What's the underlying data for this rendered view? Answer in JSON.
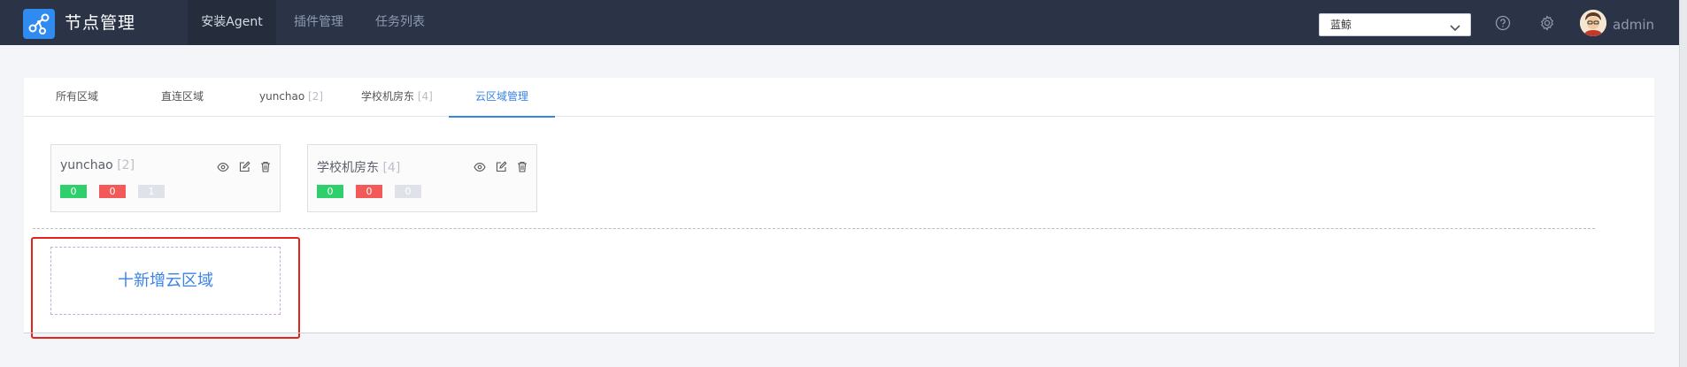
{
  "app": {
    "title": "节点管理"
  },
  "nav": {
    "items": [
      {
        "label": "安装Agent",
        "active": true
      },
      {
        "label": "插件管理",
        "active": false
      },
      {
        "label": "任务列表",
        "active": false
      }
    ]
  },
  "header": {
    "business_select": {
      "value": "蓝鲸"
    },
    "help_icon": "question-circle-icon",
    "settings_icon": "gear-icon",
    "user": {
      "name": "admin"
    }
  },
  "tabs": [
    {
      "label": "所有区域",
      "count": "",
      "active": false
    },
    {
      "label": "直连区域",
      "count": "",
      "active": false
    },
    {
      "label": "yunchao",
      "count": "[2]",
      "active": false
    },
    {
      "label": "学校机房东",
      "count": "[4]",
      "active": false
    },
    {
      "label": "云区域管理",
      "count": "",
      "active": true
    }
  ],
  "cards": [
    {
      "name": "yunchao",
      "count": "[2]",
      "normal": "0",
      "abnormal": "0",
      "other": "1"
    },
    {
      "name": "学校机房东",
      "count": "[4]",
      "normal": "0",
      "abnormal": "0",
      "other": "0"
    }
  ],
  "add_region": {
    "label": "十新增云区域"
  },
  "colors": {
    "accent": "#3a84e7",
    "topbar": "#2b3447",
    "success": "#2fcf6b",
    "danger": "#f25a5a",
    "highlight": "#e2231a"
  }
}
